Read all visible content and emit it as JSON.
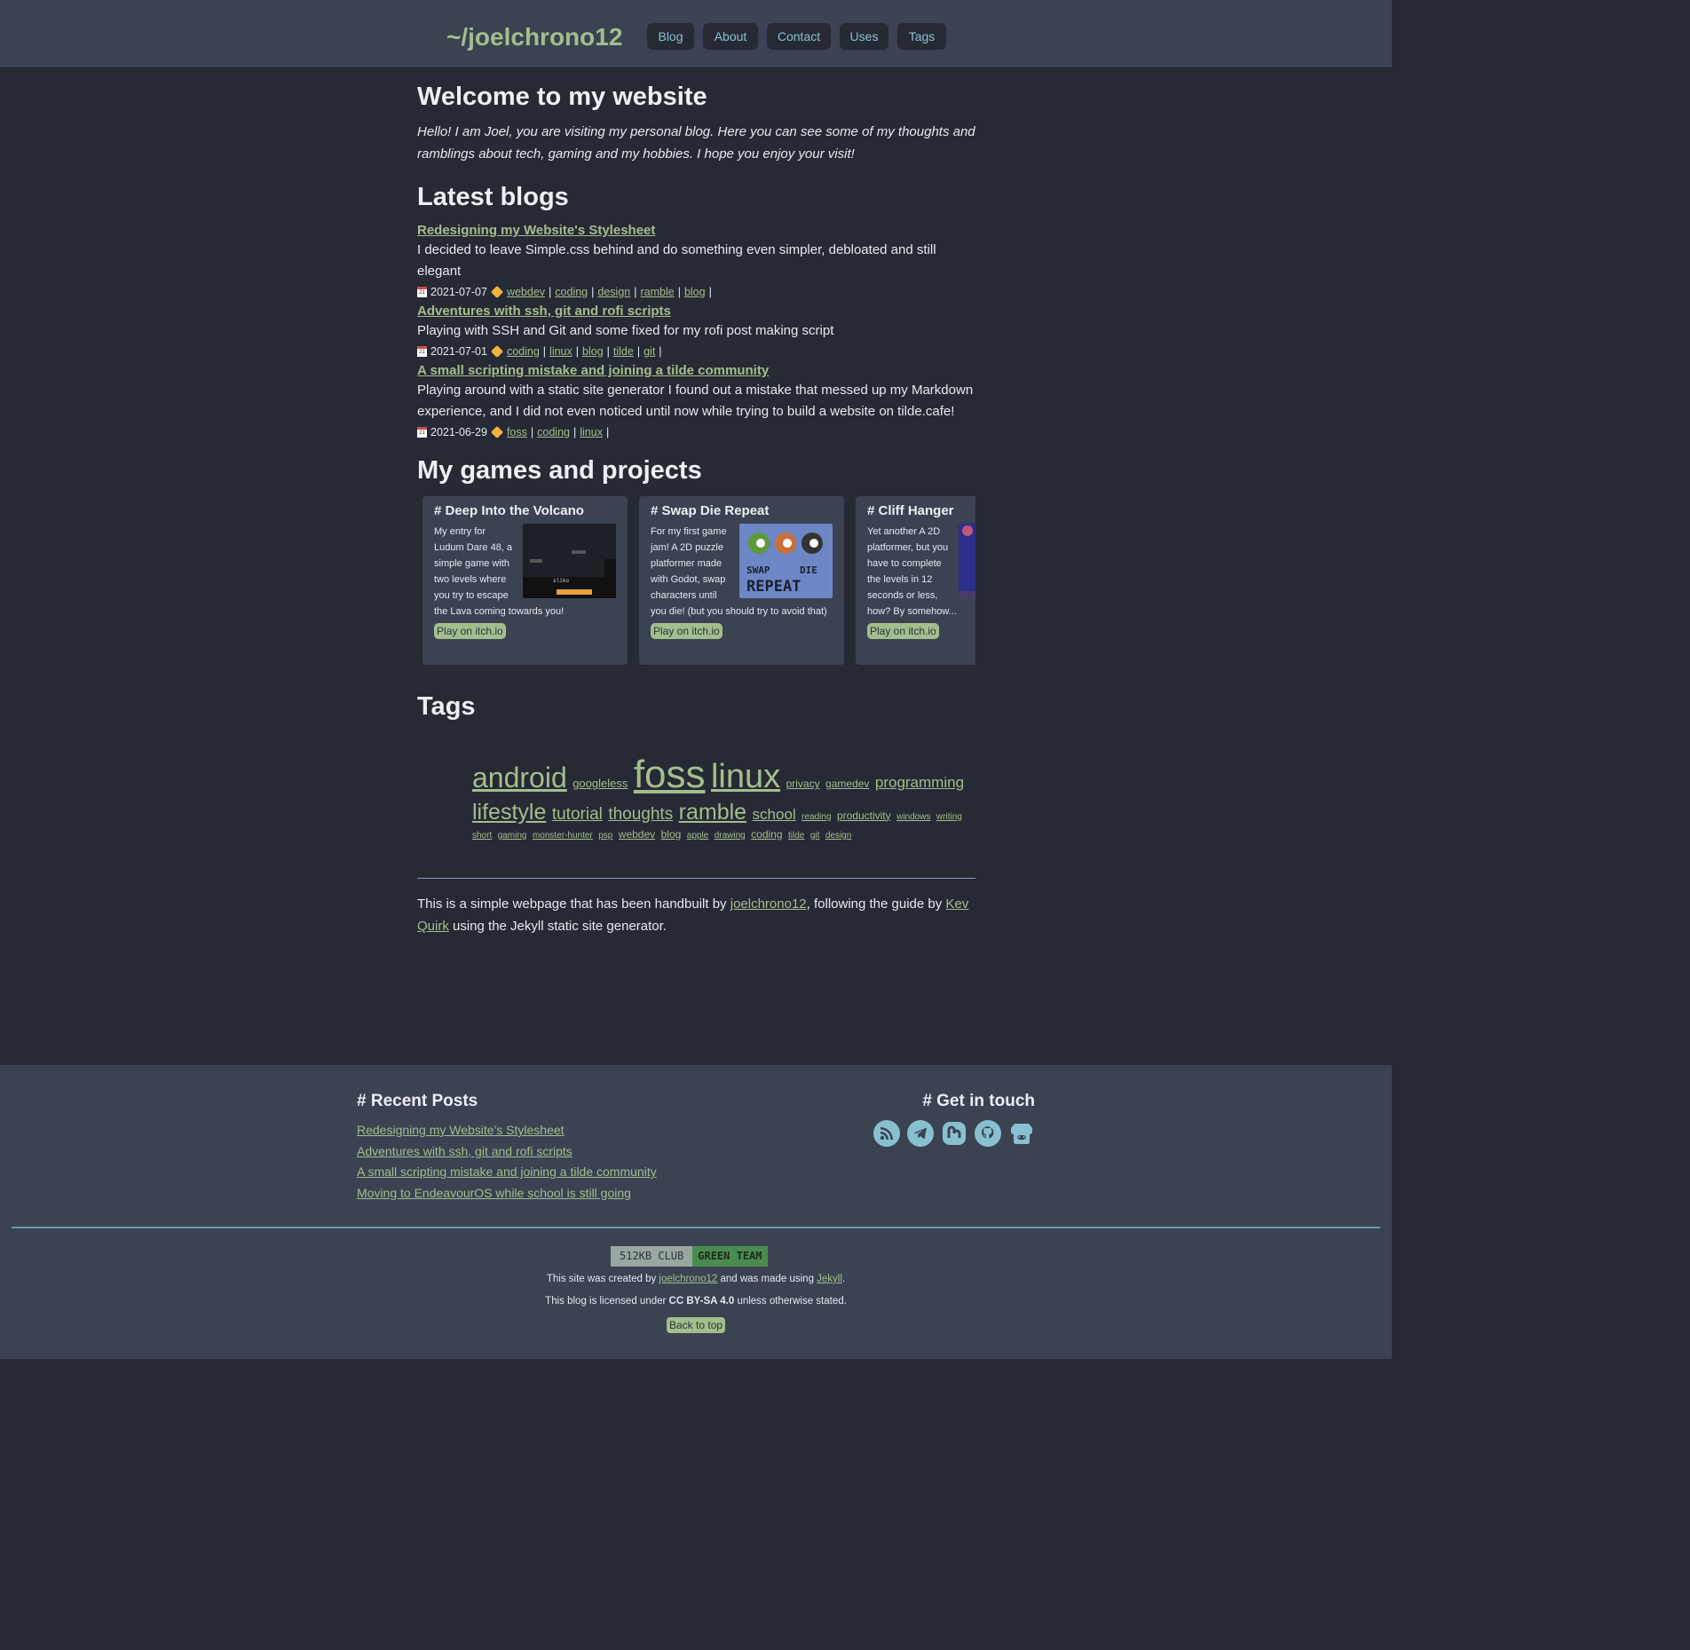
{
  "header": {
    "site_title": "~/joelchrono12",
    "nav": [
      {
        "label": "Blog"
      },
      {
        "label": "About"
      },
      {
        "label": "Contact"
      },
      {
        "label": "Uses"
      },
      {
        "label": "Tags"
      }
    ]
  },
  "main": {
    "welcome_title": "Welcome to my website",
    "intro": "Hello! I am Joel, you are visiting my personal blog. Here you can see some of my thoughts and ramblings about tech, gaming and my hobbies. I hope you enjoy your visit!",
    "latest_title": "Latest blogs",
    "posts": [
      {
        "title": "Redesigning my Website's Stylesheet",
        "desc": "I decided to leave Simple.css behind and do something even simpler, debloated and still elegant",
        "date": "2021-07-07",
        "tags": [
          "webdev",
          "coding",
          "design",
          "ramble",
          "blog"
        ]
      },
      {
        "title": "Adventures with ssh, git and rofi scripts",
        "desc": "Playing with SSH and Git and some fixed for my rofi post making script",
        "date": "2021-07-01",
        "tags": [
          "coding",
          "linux",
          "blog",
          "tilde",
          "git"
        ]
      },
      {
        "title": "A small scripting mistake and joining a tilde community",
        "desc": "Playing around with a static site generator I found out a mistake that messed up my Markdown experience, and I did not even noticed until now while trying to build a website on tilde.cafe!",
        "date": "2021-06-29",
        "tags": [
          "foss",
          "coding",
          "linux"
        ]
      }
    ],
    "games_title": "My games and projects",
    "games": [
      {
        "title": "# Deep Into the Volcano",
        "desc": "My entry for Ludum Dare 48, a simple game with two levels where you try to escape the Lava coming towards you!",
        "button": "Play on itch.io"
      },
      {
        "title": "# Swap Die Repeat",
        "desc": "For my first game jam! A 2D puzzle platformer made with Godot, swap characters until you die! (but you should try to avoid that)",
        "button": "Play on itch.io"
      },
      {
        "title": "# Cliff Hanger",
        "desc": "Yet another A 2D platformer, but you have to complete the levels in 12 seconds or less, how? By somehow...",
        "button": "Play on itch.io"
      }
    ],
    "tags_title": "Tags",
    "tag_cloud": [
      {
        "name": "android",
        "size": 32
      },
      {
        "name": "googleless",
        "size": 13
      },
      {
        "name": "foss",
        "size": 44
      },
      {
        "name": "linux",
        "size": 38
      },
      {
        "name": "privacy",
        "size": 12
      },
      {
        "name": "gamedev",
        "size": 12
      },
      {
        "name": "programming",
        "size": 17
      },
      {
        "name": "lifestyle",
        "size": 25
      },
      {
        "name": "tutorial",
        "size": 19
      },
      {
        "name": "thoughts",
        "size": 19
      },
      {
        "name": "ramble",
        "size": 25
      },
      {
        "name": "school",
        "size": 17
      },
      {
        "name": "reading",
        "size": 10
      },
      {
        "name": "productivity",
        "size": 12
      },
      {
        "name": "windows",
        "size": 10
      },
      {
        "name": "writing",
        "size": 10
      },
      {
        "name": "short",
        "size": 10
      },
      {
        "name": "gaming",
        "size": 10
      },
      {
        "name": "monster-hunter",
        "size": 10
      },
      {
        "name": "psp",
        "size": 10
      },
      {
        "name": "webdev",
        "size": 12
      },
      {
        "name": "blog",
        "size": 12
      },
      {
        "name": "apple",
        "size": 10
      },
      {
        "name": "drawing",
        "size": 10
      },
      {
        "name": "coding",
        "size": 12
      },
      {
        "name": "tilde",
        "size": 10
      },
      {
        "name": "git",
        "size": 10
      },
      {
        "name": "design",
        "size": 10
      }
    ],
    "footnote": {
      "pre": "This is a simple webpage that has been handbuilt by ",
      "author_link": "joelchrono12",
      "mid": ", following the guide by ",
      "guide_link": "Kev Quirk",
      "post": " using the Jekyll static site generator."
    }
  },
  "footer": {
    "recent_title": "# Recent Posts",
    "recent_posts": [
      "Redesigning my Website's Stylesheet",
      "Adventures with ssh, git and rofi scripts",
      "A small scripting mistake and joining a tilde community",
      "Moving to EndeavourOS while school is still going"
    ],
    "touch_title": "# Get in touch",
    "social_icons": [
      "rss-icon",
      "telegram-icon",
      "mastodon-icon",
      "github-icon",
      "itchio-icon"
    ],
    "badge_left": "512KB CLUB",
    "badge_right": "GREEN TEAM",
    "credit1_pre": "This site was created by ",
    "credit1_link1": "joelchrono12",
    "credit1_mid": " and was made using ",
    "credit1_link2": "Jekyll",
    "credit1_post": ".",
    "credit2_pre": "This blog is licensed under ",
    "credit2_bold": "CC BY-SA 4.0",
    "credit2_post": " unless otherwise stated.",
    "back_to_top": "Back to top"
  },
  "colors": {
    "accent": "#a3be8c",
    "background": "#262a35",
    "header_bg": "#3b4252",
    "nav_text": "#88c0d0"
  }
}
